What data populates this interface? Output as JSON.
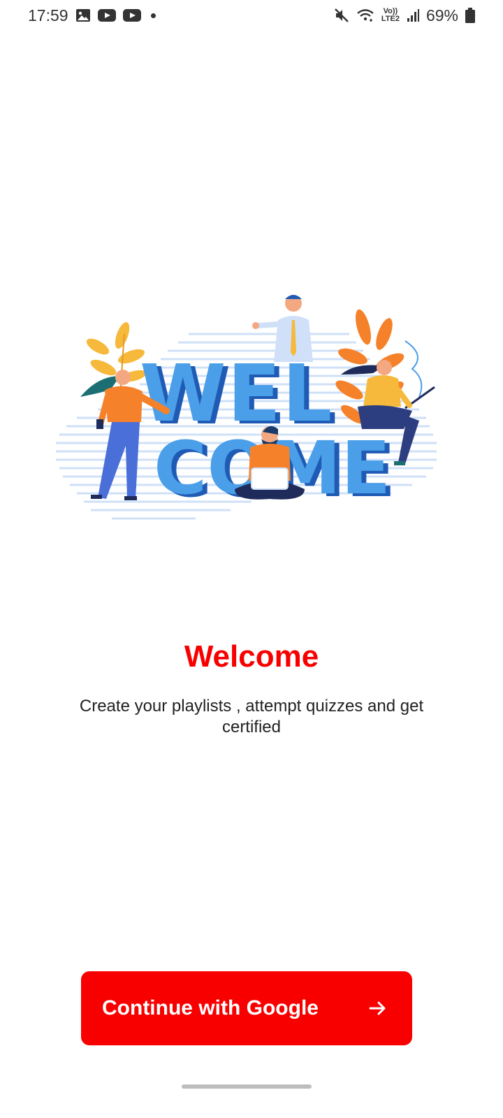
{
  "status_bar": {
    "time": "17:59",
    "notification_icons": [
      "gallery-icon",
      "youtube-icon",
      "youtube-icon"
    ],
    "volte_label": "Vo))",
    "lte_label": "LTE2",
    "battery": "69%"
  },
  "welcome": {
    "title": "Welcome",
    "subtitle": "Create your playlists , attempt quizzes and get certified"
  },
  "illustration": {
    "line1": "WEL",
    "line2": "COME"
  },
  "button": {
    "label": "Continue with Google",
    "icon": "arrow-right-icon"
  },
  "colors": {
    "accent": "#f80000",
    "illustration_blue": "#4b9ee8",
    "illustration_dark_blue": "#1f5bb5",
    "illustration_orange": "#f5822a",
    "illustration_yellow": "#f6b93b"
  }
}
